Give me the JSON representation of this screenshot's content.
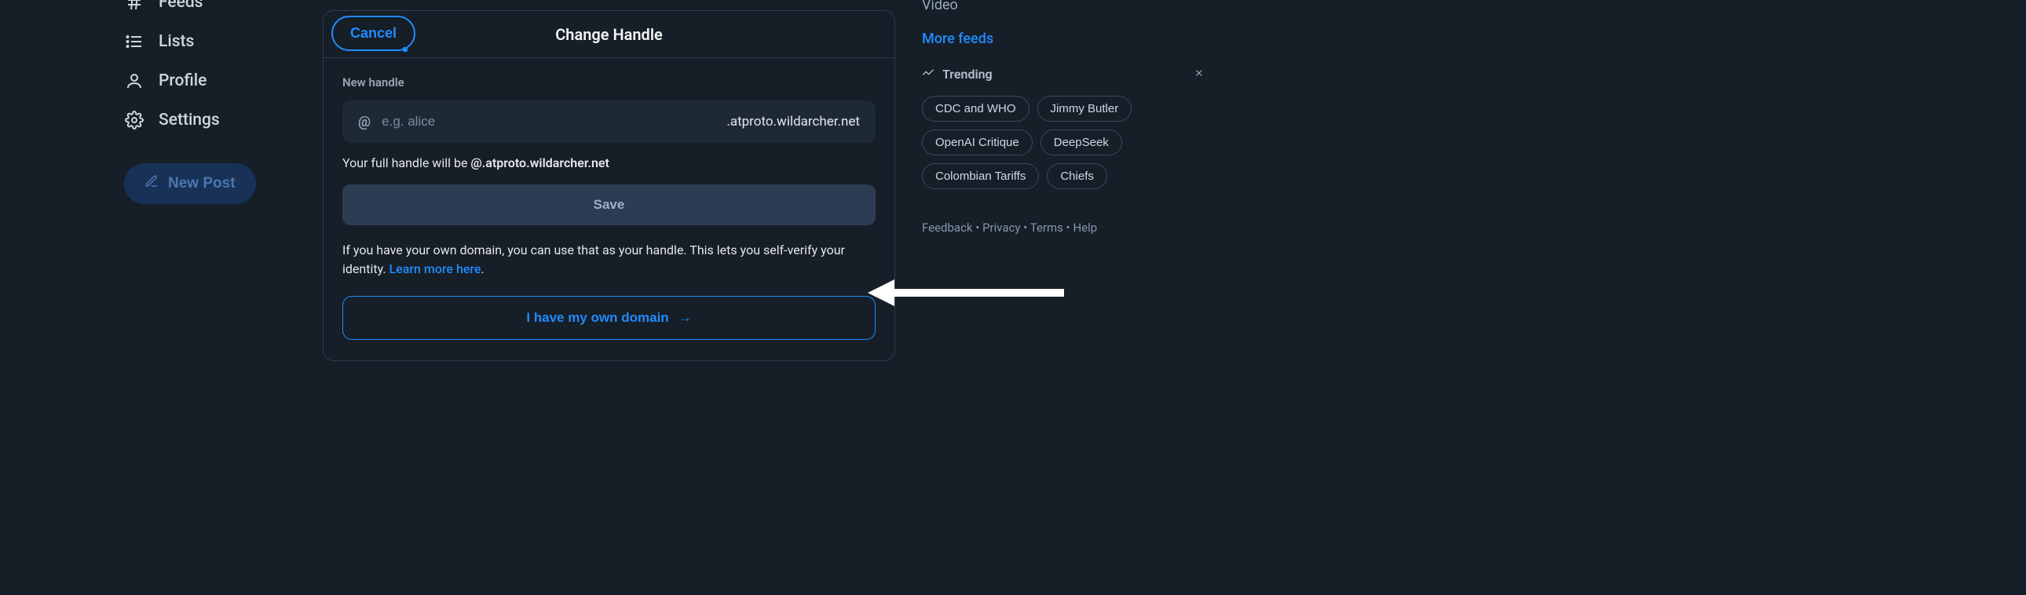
{
  "nav": {
    "items": [
      {
        "label": "Feeds"
      },
      {
        "label": "Lists"
      },
      {
        "label": "Profile"
      },
      {
        "label": "Settings"
      }
    ],
    "new_post_label": "New Post"
  },
  "modal": {
    "cancel_label": "Cancel",
    "title": "Change Handle",
    "new_handle_label": "New handle",
    "at_glyph": "@",
    "input_placeholder": "e.g. alice",
    "domain_suffix": ".atproto.wildarcher.net",
    "full_handle_prefix": "Your full handle will be ",
    "full_handle_value": "@.atproto.wildarcher.net",
    "save_label": "Save",
    "own_domain_desc": "If you have your own domain, you can use that as your handle. This lets you self-verify your identity. ",
    "learn_more_label": "Learn more here",
    "descr_period": ".",
    "own_domain_button": "I have my own domain",
    "arrow_glyph": "→"
  },
  "right": {
    "video_label": "Video",
    "more_feeds_label": "More feeds",
    "trending_label": "Trending",
    "chips": [
      "CDC and WHO",
      "Jimmy Butler",
      "OpenAI Critique",
      "DeepSeek",
      "Colombian Tariffs",
      "Chiefs"
    ],
    "footer": {
      "feedback": "Feedback",
      "privacy": "Privacy",
      "terms": "Terms",
      "help": "Help",
      "sep": " • "
    }
  }
}
